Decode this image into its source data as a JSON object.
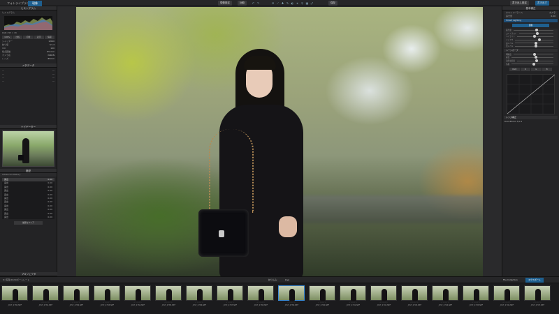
{
  "topbar": {
    "tabs": [
      "フォトライブラリ",
      "現像"
    ],
    "center_buttons": [
      "現像設定",
      "比較"
    ],
    "right_buttons": [
      "保存",
      "書き出し設定",
      "書き出す"
    ]
  },
  "left": {
    "histogram_title": "ヒストグラム",
    "histogram_label": "ヒストグラム",
    "levels": "RGB 255 1 18",
    "exif": [
      {
        "k": "シャッター",
        "v": "1/640"
      },
      {
        "k": "絞り値",
        "v": "f/1.4"
      },
      {
        "k": "ISO",
        "v": "100"
      },
      {
        "k": "焦点距離",
        "v": "85 mm"
      },
      {
        "k": "カメラ名",
        "v": "NIKON"
      },
      {
        "k": "レンズ",
        "v": "85mm"
      }
    ],
    "tool_buttons": [
      "100%",
      "比較",
      "切替",
      "表示",
      "情報"
    ],
    "meta_title": "メタデータ",
    "navigator_title": "ナビゲーター",
    "history_title": "履歴",
    "history_sub": "Advanced History",
    "history_items": [
      {
        "label": "露出",
        "val": "0.00"
      },
      {
        "label": "露出",
        "val": "0.00"
      },
      {
        "label": "露出",
        "val": "0.00"
      },
      {
        "label": "露出",
        "val": "0.00"
      },
      {
        "label": "露出",
        "val": "0.00"
      },
      {
        "label": "露出",
        "val": "0.00"
      },
      {
        "label": "露出",
        "val": "0.00"
      },
      {
        "label": "露出",
        "val": "0.00"
      },
      {
        "label": "露出",
        "val": "0.00"
      },
      {
        "label": "露出",
        "val": "0.00"
      },
      {
        "label": "露出",
        "val": "0.00"
      }
    ],
    "history_clear": "履歴をクリア",
    "footer": "プロジェクタ"
  },
  "right": {
    "basic_title": "基本補正",
    "wb_label": "ホワイトバランス",
    "wb_value": "カメラ",
    "exposure_label": "露光量",
    "exposure_value": "0.00",
    "smart_section": "Smart Lighting",
    "auto_button": "自動",
    "sliders": [
      {
        "label": "露光量",
        "pos": 0.55
      },
      {
        "label": "コントラスト",
        "pos": 0.5
      },
      {
        "label": "ハイライト",
        "pos": 0.45
      },
      {
        "label": "シャドウ",
        "pos": 0.6
      },
      {
        "label": "白レベル",
        "pos": 0.5
      },
      {
        "label": "黒レベル",
        "pos": 0.5
      }
    ],
    "tone_section": "トーンカーブ",
    "tone_sliders": [
      {
        "label": "明瞭度",
        "pos": 0.5
      },
      {
        "label": "彩度",
        "pos": 0.55
      },
      {
        "label": "自然な彩度",
        "pos": 0.5
      },
      {
        "label": "色相",
        "pos": 0.5
      }
    ],
    "curve_tabs": [
      "RGB",
      "R",
      "G",
      "B"
    ],
    "lens_section": "レンズ補正",
    "lens_value": "DxO 85mm f/1.4"
  },
  "filmbar": {
    "path": "D:\\写真\\2024\\ポートレート",
    "center_label": "絞り込み:",
    "center_value": "Live",
    "collection": "File Collection",
    "export_button": "エクスポート"
  },
  "filmstrip": [
    "_DST_2780.NEF",
    "_DST_2781.NEF",
    "_DST_2782.NEF",
    "_DST_2783.NEF",
    "_DST_2784.NEF",
    "_DST_2785.NEF",
    "_DST_2786.NEF",
    "_DST_2787.NEF",
    "_DST_2788.NEF",
    "_DST_2789.NEF",
    "_DST_2790.NEF",
    "_DST_2791.NEF",
    "_DST_2792.NEF",
    "_DST_2793.NEF",
    "_DST_2794.NEF",
    "_DST_2795.NEF",
    "_DST_2796.NEF",
    "_DST_2797.NEF"
  ]
}
